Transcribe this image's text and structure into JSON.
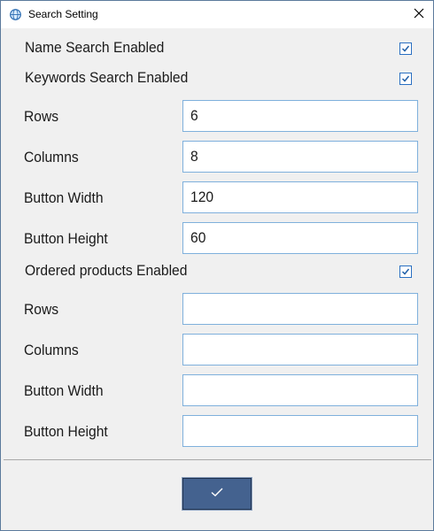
{
  "window": {
    "title": "Search Setting",
    "icon": "app-globe-icon",
    "close_icon": "close-icon"
  },
  "name_search": {
    "label": "Name Search Enabled",
    "checked": true
  },
  "keywords_search": {
    "label": "Keywords Search Enabled",
    "checked": true
  },
  "keyword_fields": [
    {
      "label": "Rows",
      "value": "6"
    },
    {
      "label": "Columns",
      "value": "8"
    },
    {
      "label": "Button Width",
      "value": "120"
    },
    {
      "label": "Button Height",
      "value": "60"
    }
  ],
  "ordered_products": {
    "label": "Ordered products Enabled",
    "checked": true
  },
  "ordered_fields": [
    {
      "label": "Rows",
      "value": ""
    },
    {
      "label": "Columns",
      "value": ""
    },
    {
      "label": "Button Width",
      "value": ""
    },
    {
      "label": "Button Height",
      "value": ""
    }
  ],
  "footer": {
    "confirm_icon": "checkmark-icon"
  },
  "colors": {
    "accent": "#44628f",
    "checkbox_border": "#2a70c2",
    "field_border": "#7fb0dc"
  }
}
